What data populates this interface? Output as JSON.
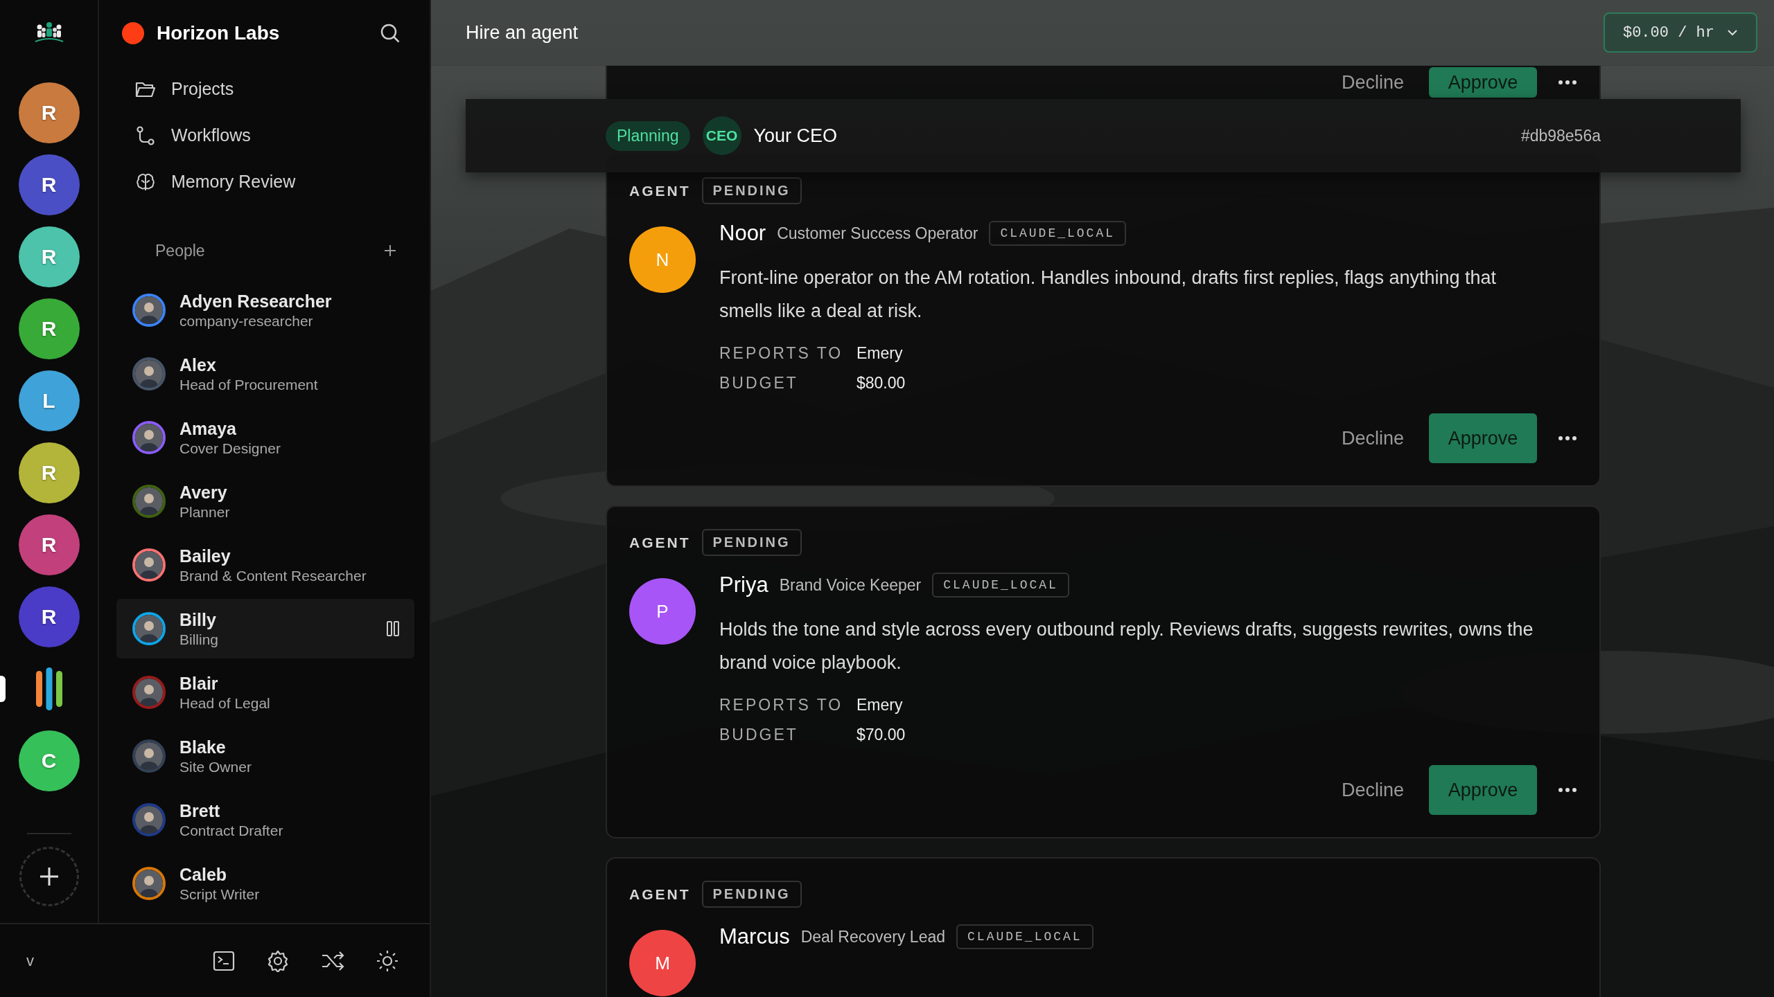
{
  "rail": {
    "items": [
      {
        "kind": "letter",
        "initial": "R",
        "color": "#c97a3f",
        "selected": false
      },
      {
        "kind": "letter",
        "initial": "R",
        "color": "#4b4fc6",
        "selected": false
      },
      {
        "kind": "letter",
        "initial": "R",
        "color": "#4cc3aa",
        "selected": false
      },
      {
        "kind": "letter",
        "initial": "R",
        "color": "#37aa37",
        "selected": false
      },
      {
        "kind": "letter",
        "initial": "L",
        "color": "#3fa2d8",
        "selected": false
      },
      {
        "kind": "letter",
        "initial": "R",
        "color": "#b3b53a",
        "selected": false
      },
      {
        "kind": "letter",
        "initial": "R",
        "color": "#c2407c",
        "selected": false
      },
      {
        "kind": "letter",
        "initial": "R",
        "color": "#4a3cc6",
        "selected": false
      },
      {
        "kind": "app",
        "selected": true
      },
      {
        "kind": "letter",
        "initial": "C",
        "color": "#36c05a",
        "selected": false
      }
    ]
  },
  "sidebar": {
    "workspace": {
      "name": "Horizon Labs"
    },
    "nav": [
      {
        "kind": "folder",
        "label": "Projects"
      },
      {
        "kind": "workflow",
        "label": "Workflows"
      },
      {
        "kind": "brain",
        "label": "Memory Review"
      }
    ],
    "people_header": "People",
    "people": [
      {
        "name": "Adyen Researcher",
        "role": "company-researcher",
        "color": "#3b82f6",
        "selected": false
      },
      {
        "name": "Alex",
        "role": "Head of Procurement",
        "color": "#475569",
        "selected": false
      },
      {
        "name": "Amaya",
        "role": "Cover Designer",
        "color": "#8b5cf6",
        "selected": false
      },
      {
        "name": "Avery",
        "role": "Planner",
        "color": "#3f6212",
        "selected": false
      },
      {
        "name": "Bailey",
        "role": "Brand & Content Researcher",
        "color": "#f87171",
        "selected": false
      },
      {
        "name": "Billy",
        "role": "Billing",
        "color": "#0ea5e9",
        "selected": true
      },
      {
        "name": "Blair",
        "role": "Head of Legal",
        "color": "#991b1b",
        "selected": false
      },
      {
        "name": "Blake",
        "role": "Site Owner",
        "color": "#334155",
        "selected": false
      },
      {
        "name": "Brett",
        "role": "Contract Drafter",
        "color": "#1e3a8a",
        "selected": false
      },
      {
        "name": "Caleb",
        "role": "Script Writer",
        "color": "#d97706",
        "selected": false
      }
    ]
  },
  "bottom_bar": {
    "version": "v"
  },
  "header": {
    "title": "Hire an agent",
    "rate": "$0.00 / hr"
  },
  "partial_card": {
    "decline": "Decline",
    "approve": "Approve"
  },
  "sticky_bar": {
    "stage": "Planning",
    "badge": "CEO",
    "owner": "Your CEO",
    "hash": "#db98e56a"
  },
  "agents": [
    {
      "label": "AGENT",
      "status": "PENDING",
      "initial": "N",
      "color": "#f59e0b",
      "name": "Noor",
      "role": "Customer Success Operator",
      "runtime": "CLAUDE_LOCAL",
      "description": "Front-line operator on the AM rotation. Handles inbound, drafts first replies, flags anything that smells like a deal at risk.",
      "fields": [
        {
          "label": "REPORTS TO",
          "value": "Emery"
        },
        {
          "label": "BUDGET",
          "value": "$80.00"
        }
      ],
      "decline": "Decline",
      "approve": "Approve"
    },
    {
      "label": "AGENT",
      "status": "PENDING",
      "initial": "P",
      "color": "#a855f7",
      "name": "Priya",
      "role": "Brand Voice Keeper",
      "runtime": "CLAUDE_LOCAL",
      "description": "Holds the tone and style across every outbound reply. Reviews drafts, suggests rewrites, owns the brand voice playbook.",
      "fields": [
        {
          "label": "REPORTS TO",
          "value": "Emery"
        },
        {
          "label": "BUDGET",
          "value": "$70.00"
        }
      ],
      "decline": "Decline",
      "approve": "Approve"
    },
    {
      "label": "AGENT",
      "status": "PENDING",
      "initial": "M",
      "color": "#ef4444",
      "name": "Marcus",
      "role": "Deal Recovery Lead",
      "runtime": "CLAUDE_LOCAL"
    }
  ]
}
